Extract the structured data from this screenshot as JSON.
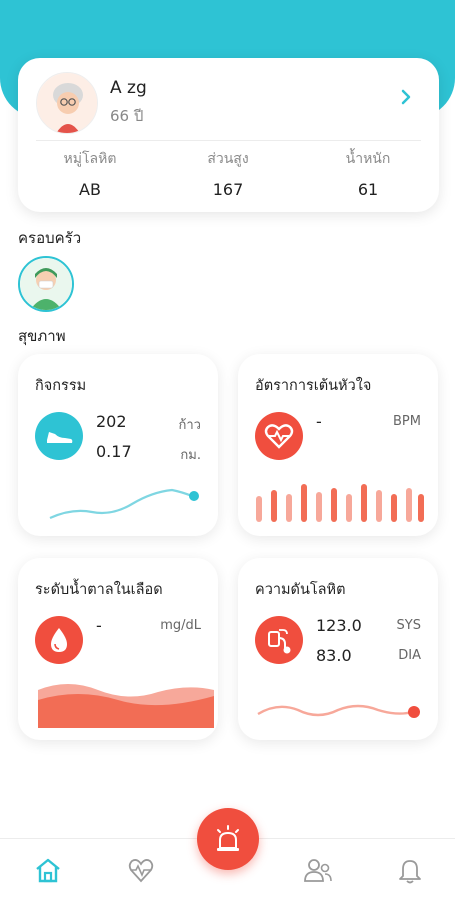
{
  "profile": {
    "name": "A   zg",
    "age": "66 ปี",
    "stats": [
      {
        "label": "หมู่โลหิต",
        "value": "AB"
      },
      {
        "label": "ส่วนสูง",
        "value": "167"
      },
      {
        "label": "น้ำหนัก",
        "value": "61"
      }
    ]
  },
  "sections": {
    "family": "ครอบครัว",
    "health": "สุขภาพ"
  },
  "cards": {
    "activity": {
      "title": "กิจกรรม",
      "steps_value": "202",
      "steps_unit": "ก้าว",
      "distance_value": "0.17",
      "distance_unit": "กม."
    },
    "heart": {
      "title": "อัตราการเต้นหัวใจ",
      "value": "-",
      "unit": "BPM"
    },
    "glucose": {
      "title": "ระดับน้ำตาลในเลือด",
      "value": "-",
      "unit": "mg/dL"
    },
    "pressure": {
      "title": "ความดันโลหิต",
      "sys_value": "123.0",
      "sys_label": "SYS",
      "dia_value": "83.0",
      "dia_label": "DIA"
    }
  },
  "colors": {
    "primary": "#2ec3d4",
    "accent": "#f04e3e",
    "chart_red": "#f26d55"
  },
  "icons": {
    "nav": [
      "home-icon",
      "heart-pulse-icon",
      "siren-icon",
      "family-icon",
      "bell-icon"
    ]
  }
}
